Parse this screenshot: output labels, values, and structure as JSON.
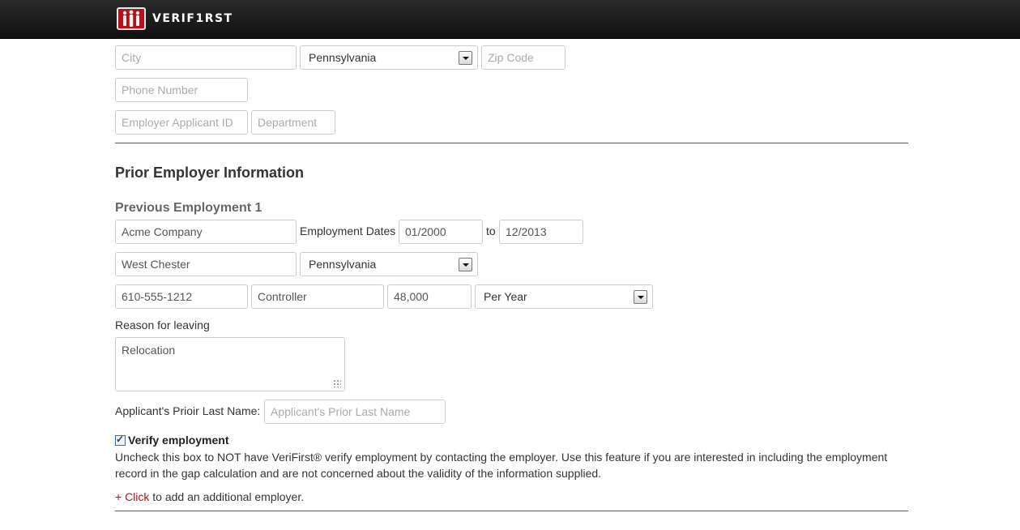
{
  "header": {
    "brand": "VERIF1RST"
  },
  "address": {
    "city_placeholder": "City",
    "state_value": "Pennsylvania",
    "zip_placeholder": "Zip Code",
    "phone_placeholder": "Phone Number",
    "employer_applicant_id_placeholder": "Employer Applicant ID",
    "department_placeholder": "Department"
  },
  "prior_employer": {
    "section_title": "Prior Employer Information",
    "subsection_title": "Previous Employment 1",
    "company_value": "Acme Company",
    "employment_dates_label": "Employment Dates",
    "start_date_value": "01/2000",
    "to_label": "to",
    "end_date_value": "12/2013",
    "city_value": "West Chester",
    "state_value": "Pennsylvania",
    "phone_value": "610-555-1212",
    "title_value": "Controller",
    "salary_value": "48,000",
    "pay_period_value": "Per Year",
    "reason_label": "Reason for leaving",
    "reason_value": "Relocation",
    "prior_last_name_label": "Applicant's Prioir Last Name:",
    "prior_last_name_placeholder": "Applicant's Prior Last Name",
    "verify_label": "Verify employment",
    "verify_checked": true,
    "verify_description": "Uncheck this box to NOT have VeriFirst® verify employment by contacting the employer. Use this feature if you are interested in including the employment record in the gap calculation and are not concerned about the validity of the information supplied.",
    "add_link_text": "+ Click",
    "add_suffix": " to add an additional employer."
  },
  "colors": {
    "header_bg": "#111111",
    "link_red": "#b5121b",
    "logo_red": "#b3121a"
  }
}
